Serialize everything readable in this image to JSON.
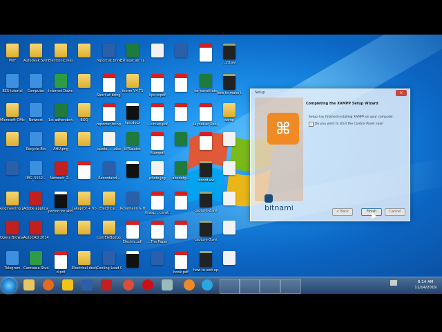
{
  "desktop": {
    "icons": [
      {
        "label": "PNY",
        "type": "folder"
      },
      {
        "label": "Autodesk Symbol...",
        "type": "folder"
      },
      {
        "label": "Electronic lesson",
        "type": "folder"
      },
      {
        "label": "",
        "type": "folder"
      },
      {
        "label": "report at bring ken...",
        "type": "word"
      },
      {
        "label": "Exhaust air calculati...",
        "type": "excel"
      },
      {
        "label": "",
        "type": "white"
      },
      {
        "label": "",
        "type": "word"
      },
      {
        "label": "",
        "type": "pdf"
      },
      {
        "label": "...2d.avi",
        "type": "media"
      },
      {
        "label": "BSS tutorial",
        "type": "blue"
      },
      {
        "label": "Computer",
        "type": "blue"
      },
      {
        "label": "Internet Downlo...",
        "type": "green"
      },
      {
        "label": "",
        "type": "folder"
      },
      {
        "label": "Sport at bring ken...",
        "type": "pdf"
      },
      {
        "label": "thorm V4 T1",
        "type": "folder"
      },
      {
        "label": "kps ccpdf",
        "type": "pdf"
      },
      {
        "label": "",
        "type": "pdf"
      },
      {
        "label": "for constitute",
        "type": "excel"
      },
      {
        "label": "how to make layer.avi",
        "type": "media"
      },
      {
        "label": "Microsoft Office Pro...",
        "type": "folder"
      },
      {
        "label": "Network",
        "type": "blue"
      },
      {
        "label": "1st adhendert...",
        "type": "excel"
      },
      {
        "label": "BOQ",
        "type": "folder"
      },
      {
        "label": "reporter bring ken...",
        "type": "pdf"
      },
      {
        "label": "kps.docx",
        "type": "black"
      },
      {
        "label": "...circuit.pdf",
        "type": "pdf"
      },
      {
        "label": "",
        "type": "pdf"
      },
      {
        "label": "layout ar Xpo.pdf",
        "type": "pdf"
      },
      {
        "label": "xamp",
        "type": "folder"
      },
      {
        "label": "",
        "type": "folder"
      },
      {
        "label": "Recycle Bin",
        "type": "blue"
      },
      {
        "label": "AHU.png",
        "type": "folder"
      },
      {
        "label": "",
        "type": "folder"
      },
      {
        "label": "quote ... .xlsx",
        "type": "white"
      },
      {
        "label": "kPSa.xlsx",
        "type": "excel"
      },
      {
        "label": "Elampdf",
        "type": "pdf"
      },
      {
        "label": "",
        "type": "excel"
      },
      {
        "label": "",
        "type": "pdf"
      },
      {
        "label": "",
        "type": "white"
      },
      {
        "label": "",
        "type": "word"
      },
      {
        "label": "IMG_5552...",
        "type": "blue"
      },
      {
        "label": "Network_2...",
        "type": "red"
      },
      {
        "label": "",
        "type": "pdf"
      },
      {
        "label": "Recordand...",
        "type": "word"
      },
      {
        "label": "",
        "type": "black"
      },
      {
        "label": "photo.jpg",
        "type": "white"
      },
      {
        "label": "abcdefg...",
        "type": "excel"
      },
      {
        "label": "record.avi",
        "type": "media"
      },
      {
        "label": "",
        "type": "white"
      },
      {
        "label": "engineering profession...",
        "type": "folder"
      },
      {
        "label": "Adobe application...",
        "type": "red"
      },
      {
        "label": "period for abhendert...",
        "type": "black"
      },
      {
        "label": "Lakeprof + frontline",
        "type": "folder"
      },
      {
        "label": "Electrical...",
        "type": "folder"
      },
      {
        "label": "Rossmann & Blackpower",
        "type": "word"
      },
      {
        "label": "Grasp... cerat.pdf",
        "type": "pdf"
      },
      {
        "label": "",
        "type": "pdf"
      },
      {
        "label": "capture-2.avi",
        "type": "media"
      },
      {
        "label": "",
        "type": "white"
      },
      {
        "label": "Opera Browser",
        "type": "red"
      },
      {
        "label": "AutoCAD 2014 - En...",
        "type": "red"
      },
      {
        "label": "",
        "type": "folder"
      },
      {
        "label": "",
        "type": "folder"
      },
      {
        "label": "ComEleBoxLod...",
        "type": "folder"
      },
      {
        "label": "Electric.pdf",
        "type": "pdf"
      },
      {
        "label": "...The Paper",
        "type": "pdf"
      },
      {
        "label": "",
        "type": "pdf"
      },
      {
        "label": "capture-3.avi",
        "type": "media"
      },
      {
        "label": "",
        "type": "white"
      },
      {
        "label": "Telegram",
        "type": "blue"
      },
      {
        "label": "Camtasia Studio 9",
        "type": "green"
      },
      {
        "label": "d.pdf",
        "type": "pdf"
      },
      {
        "label": "Electrical design Bo...",
        "type": "folder"
      },
      {
        "label": "Cooling Load Calculation...",
        "type": "word"
      },
      {
        "label": "",
        "type": "black"
      },
      {
        "label": "",
        "type": "word"
      },
      {
        "label": "book.pdf",
        "type": "pdf"
      },
      {
        "label": "how to sort option on...",
        "type": "media"
      },
      {
        "label": "",
        "type": "white"
      }
    ]
  },
  "dialog": {
    "title": "Setup",
    "close": "✕",
    "heading": "Completing the XAMPP Setup Wizard",
    "body": "Setup has finished installing XAMPP on your computer.",
    "checkbox_label": "Do you want to start the Control Panel now?",
    "checkbox_mark": "✓",
    "logo_glyph": "⌘",
    "brand": "bitnami",
    "back_label": "< Back",
    "finish_label": "Finish",
    "cancel_label": "Cancel"
  },
  "taskbar": {
    "time": "8:14 AM",
    "date": "11/14/2019"
  }
}
